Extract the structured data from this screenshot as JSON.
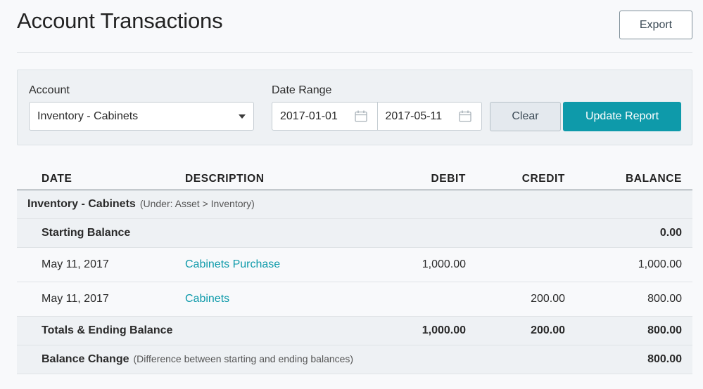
{
  "header": {
    "title": "Account Transactions",
    "export_label": "Export"
  },
  "filters": {
    "account_label": "Account",
    "account_value": "Inventory - Cabinets",
    "date_range_label": "Date Range",
    "start_date": "2017-01-01",
    "end_date": "2017-05-11",
    "clear_label": "Clear",
    "update_label": "Update Report"
  },
  "table": {
    "columns": {
      "date": "DATE",
      "description": "DESCRIPTION",
      "debit": "DEBIT",
      "credit": "CREDIT",
      "balance": "BALANCE"
    },
    "group": {
      "name": "Inventory - Cabinets",
      "sub": "(Under: Asset > Inventory)"
    },
    "starting": {
      "label": "Starting Balance",
      "balance": "0.00"
    },
    "rows": [
      {
        "date": "May 11, 2017",
        "description": "Cabinets Purchase",
        "debit": "1,000.00",
        "credit": "",
        "balance": "1,000.00"
      },
      {
        "date": "May 11, 2017",
        "description": "Cabinets",
        "debit": "",
        "credit": "200.00",
        "balance": "800.00"
      }
    ],
    "totals": {
      "label": "Totals & Ending Balance",
      "debit": "1,000.00",
      "credit": "200.00",
      "balance": "800.00"
    },
    "change": {
      "label": "Balance Change",
      "note": "(Difference between starting and ending balances)",
      "balance": "800.00"
    }
  },
  "colors": {
    "accent": "#0e9aaa",
    "panel_bg": "#eef1f4",
    "page_bg": "#f8f9fb"
  }
}
